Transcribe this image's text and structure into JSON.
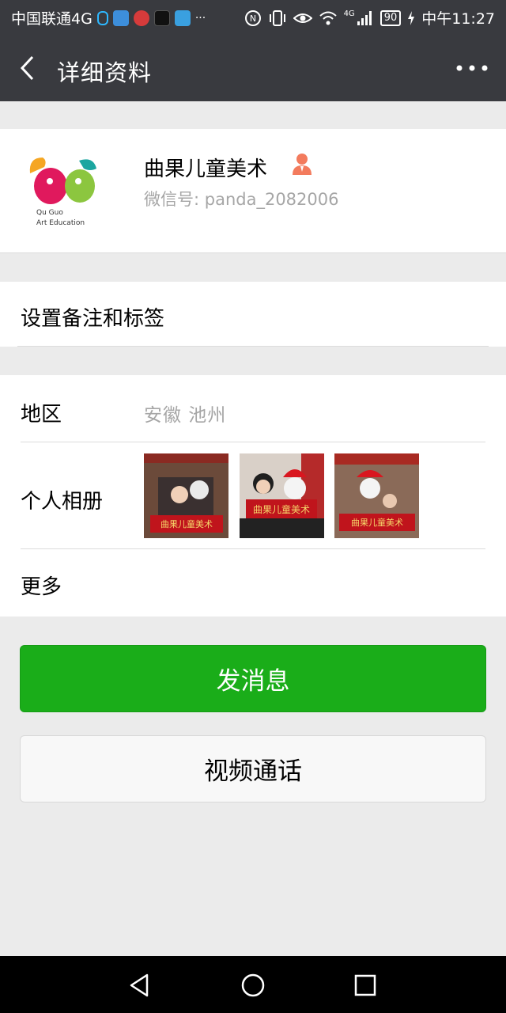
{
  "status_bar": {
    "carrier": "中国联通4G",
    "ellipsis": "···",
    "network_type": "4G",
    "battery": "90",
    "time": "中午11:27"
  },
  "nav": {
    "title": "详细资料",
    "back_icon": "chevron-left-icon",
    "more_icon": "more-dots-icon"
  },
  "profile": {
    "name": "曲果儿童美术",
    "wechat_id": "微信号: panda_2082006",
    "logo_text_line1": "Qu Guo",
    "logo_text_line2": "Art Education"
  },
  "remark": {
    "label": "设置备注和标签"
  },
  "info": {
    "region_label": "地区",
    "region_value": "安徽  池州",
    "album_label": "个人相册",
    "album_banner": "曲果儿童美术",
    "more_label": "更多"
  },
  "actions": {
    "send_message": "发消息",
    "video_call": "视频通话"
  },
  "colors": {
    "primary_green": "#1aad19",
    "header_dark": "#393a3f",
    "badge_orange": "#f37b5d"
  }
}
